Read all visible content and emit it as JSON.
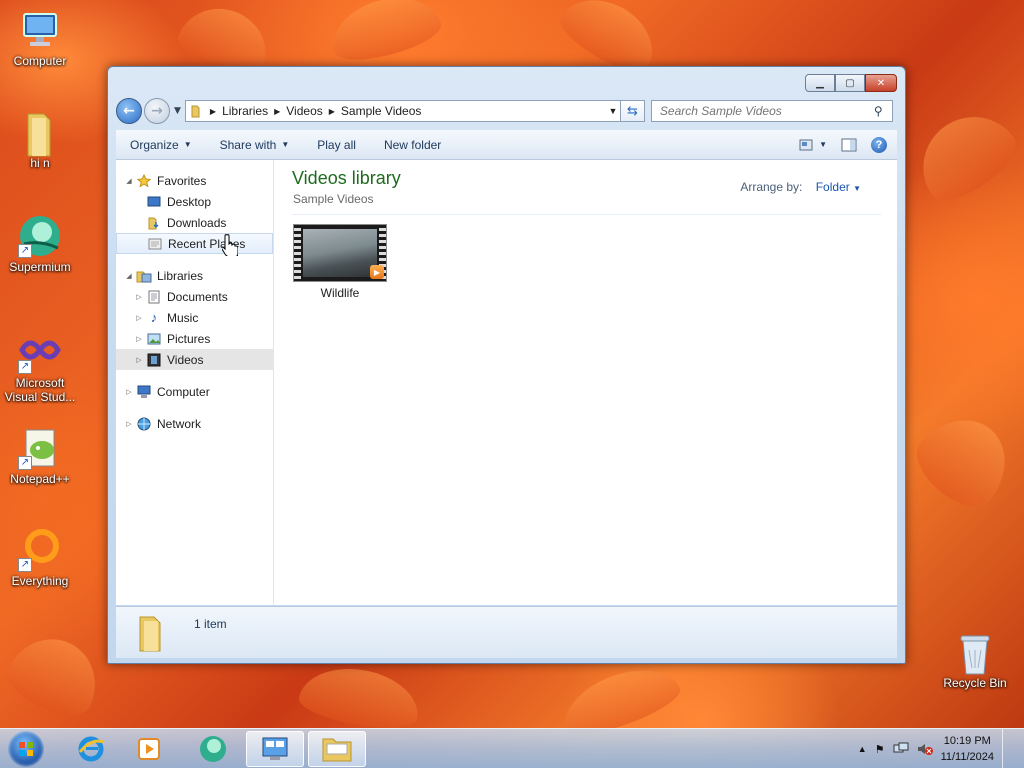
{
  "desktop": {
    "icons": [
      {
        "label": "Computer"
      },
      {
        "label": "hi n"
      },
      {
        "label": "Supermium"
      },
      {
        "label": "Microsoft Visual Stud..."
      },
      {
        "label": "Notepad++"
      },
      {
        "label": "Everything"
      },
      {
        "label": "Recycle Bin"
      }
    ]
  },
  "window": {
    "address": {
      "crumbs": [
        "Libraries",
        "Videos",
        "Sample Videos"
      ]
    },
    "search": {
      "placeholder": "Search Sample Videos"
    },
    "toolbar": {
      "organize": "Organize",
      "share_with": "Share with",
      "play_all": "Play all",
      "new_folder": "New folder"
    },
    "nav": {
      "favorites": "Favorites",
      "desktop": "Desktop",
      "downloads": "Downloads",
      "recent_places": "Recent Places",
      "libraries": "Libraries",
      "documents": "Documents",
      "music": "Music",
      "pictures": "Pictures",
      "videos": "Videos",
      "computer": "Computer",
      "network": "Network"
    },
    "content": {
      "title": "Videos library",
      "subtitle": "Sample Videos",
      "arrange_by_label": "Arrange by:",
      "arrange_by_value": "Folder",
      "files": [
        {
          "name": "Wildlife"
        }
      ]
    },
    "details": {
      "item_count": "1 item"
    }
  },
  "taskbar": {
    "clock": {
      "time": "10:19 PM",
      "date": "11/11/2024"
    }
  },
  "colors": {
    "library_title": "#1e6b1e",
    "accent_link": "#1a56b0",
    "close_button": "#c7412a"
  }
}
